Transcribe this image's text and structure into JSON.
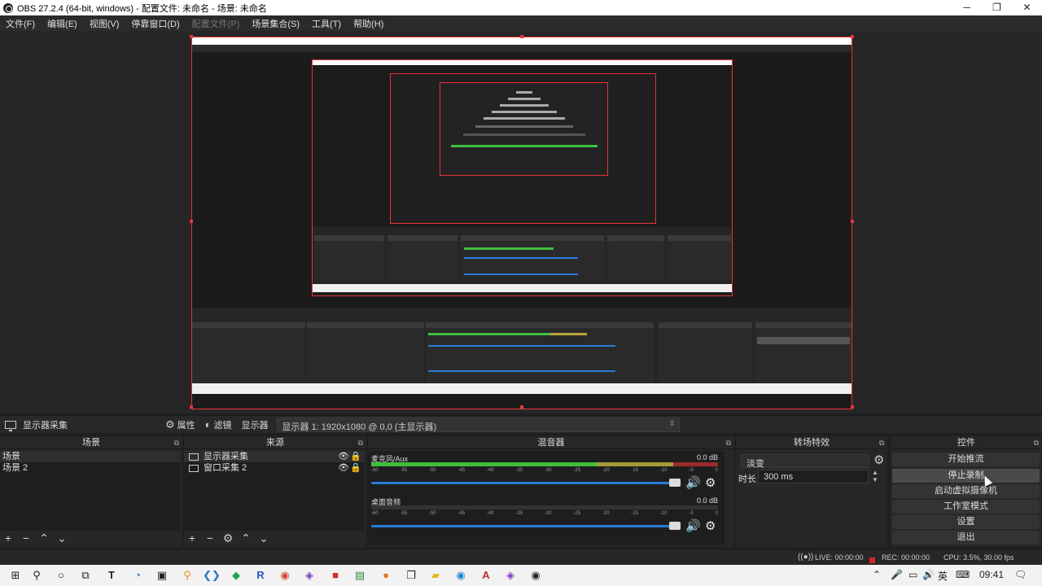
{
  "window": {
    "title": "OBS 27.2.4 (64-bit, windows) - 配置文件: 未命名 - 场景: 未命名",
    "minimize": "─",
    "maximize": "❐",
    "close": "✕"
  },
  "menu": [
    "文件(F)",
    "编辑(E)",
    "视图(V)",
    "停靠窗口(D)",
    "配置文件(P)",
    "场景集合(S)",
    "工具(T)",
    "帮助(H)"
  ],
  "source_toolbar": {
    "source_name": "显示器采集",
    "properties": "属性",
    "filters": "滤镜",
    "display_label": "显示器",
    "display_value": "显示器 1: 1920x1080 @ 0,0 (主显示器)"
  },
  "scenes": {
    "title": "场景",
    "items": [
      "场景",
      "场景 2"
    ]
  },
  "sources": {
    "title": "来源",
    "items": [
      "显示器采集",
      "窗口采集 2"
    ]
  },
  "mixer": {
    "title": "混音器",
    "channels": [
      {
        "name": "麦克风/Aux",
        "db": "0.0 dB"
      },
      {
        "name": "桌面音频",
        "db": "0.0 dB"
      }
    ],
    "ticks": [
      "-60",
      "-55",
      "-50",
      "-45",
      "-40",
      "-35",
      "-30",
      "-25",
      "-20",
      "-15",
      "-10",
      "-5",
      "0"
    ]
  },
  "transitions": {
    "title": "转场特效",
    "selected": "淡变",
    "duration_label": "时长",
    "duration": "300 ms"
  },
  "controls": {
    "title": "控件",
    "buttons": [
      "开始推流",
      "停止录制",
      "启动虚拟摄像机",
      "工作室模式",
      "设置",
      "退出"
    ]
  },
  "status": {
    "live": "LIVE: 00:00:00",
    "rec": "REC: 00:00:00",
    "cpu": "CPU: 3.5%, 30.00 fps"
  },
  "taskbar": {
    "time": "09:41",
    "lang": "英"
  },
  "colors": {
    "accent_red": "#e6343a",
    "meter_green": "#3fbf3f",
    "volume_blue": "#2a7bd8"
  }
}
